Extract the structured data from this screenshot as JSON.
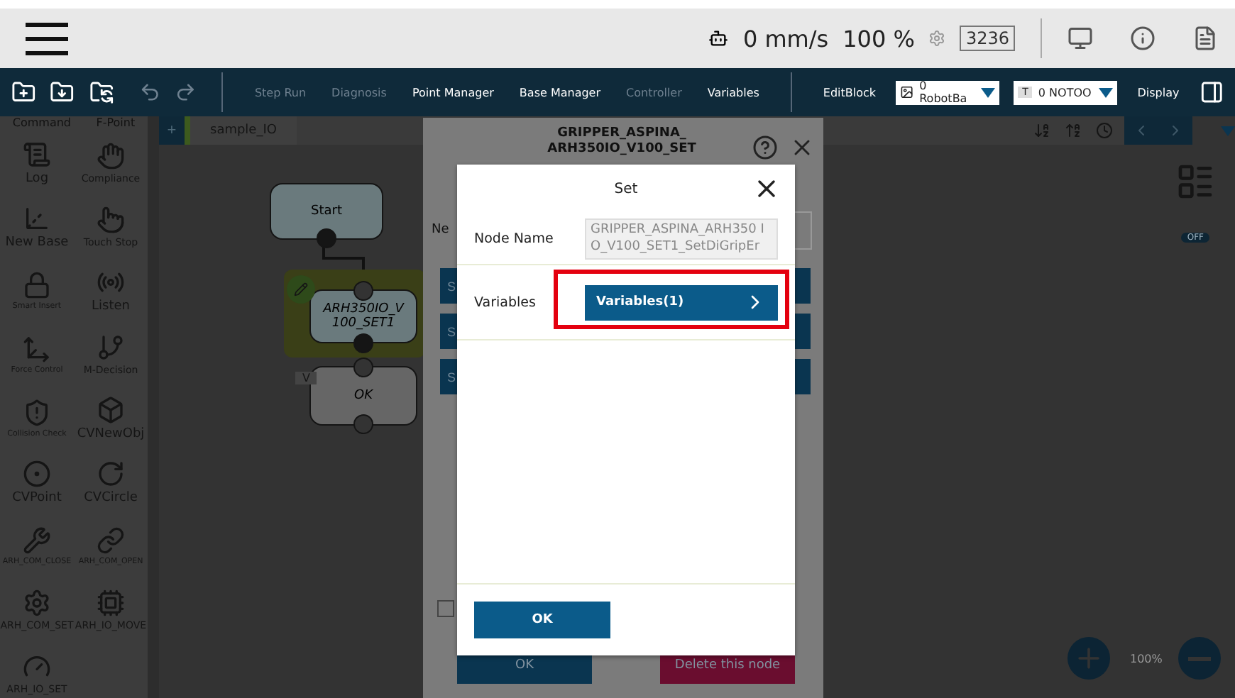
{
  "top_bar": {
    "speed": "0 mm/s",
    "percent": "100 %",
    "counter": "3236"
  },
  "toolbar": {
    "actions": [
      {
        "label": "Step Run",
        "disabled": true
      },
      {
        "label": "Diagnosis",
        "disabled": true
      },
      {
        "label": "Point Manager",
        "disabled": false
      },
      {
        "label": "Base Manager",
        "disabled": false
      },
      {
        "label": "Controller",
        "disabled": true
      },
      {
        "label": "Variables",
        "disabled": false
      }
    ],
    "edit_block": "EditBlock",
    "robot_select": {
      "value": "0 RobotBa"
    },
    "tool_select": {
      "badge": "T",
      "value": "0 NOTOO"
    },
    "display": "Display"
  },
  "sidebar": {
    "header": [
      "Command",
      "F-Point"
    ],
    "items": [
      {
        "label": "Log"
      },
      {
        "label": "Compliance"
      },
      {
        "label": "New Base"
      },
      {
        "label": "Touch Stop"
      },
      {
        "label": "Smart Insert"
      },
      {
        "label": "Listen"
      },
      {
        "label": "Force Control"
      },
      {
        "label": "M-Decision"
      },
      {
        "label": "Collision Check"
      },
      {
        "label": "CVNewObj"
      },
      {
        "label": "CVPoint"
      },
      {
        "label": "CVCircle"
      },
      {
        "label": "ARH_COM_CLOSE"
      },
      {
        "label": "ARH_COM_OPEN"
      },
      {
        "label": "ARH_COM_SET"
      },
      {
        "label": "ARH_IO_MOVE"
      },
      {
        "label": "ARH_IO_SET"
      }
    ]
  },
  "canvas": {
    "add_tab": "+",
    "tabs": [
      {
        "label": "sample_IO",
        "selected": true
      }
    ],
    "nodes": [
      {
        "kind": "start",
        "label": "Start"
      },
      {
        "kind": "selected",
        "label": "ARH350IO_V 100_SET1"
      },
      {
        "kind": "variable",
        "label": "OK",
        "tag": "V"
      }
    ],
    "toggle": {
      "label": "OFF",
      "on": false
    },
    "zoom": "100%"
  },
  "node_dialog": {
    "title": [
      "GRIPPER_ASPINA_",
      "ARH350IO_V100_SET"
    ],
    "field_label": "Ne",
    "setting_buttons": [
      "S",
      "S",
      "S"
    ],
    "checked": false,
    "ok": "OK",
    "delete": "Delete this node"
  },
  "set_dialog": {
    "title": "Set",
    "node_name_label": "Node Name",
    "node_name_value": "GRIPPER_ASPINA_ARH350 IO_V100_SET1_SetDiGripEr",
    "variables_label": "Variables",
    "variables_button": "Variables(1)",
    "highlighted": true,
    "ok": "OK"
  }
}
